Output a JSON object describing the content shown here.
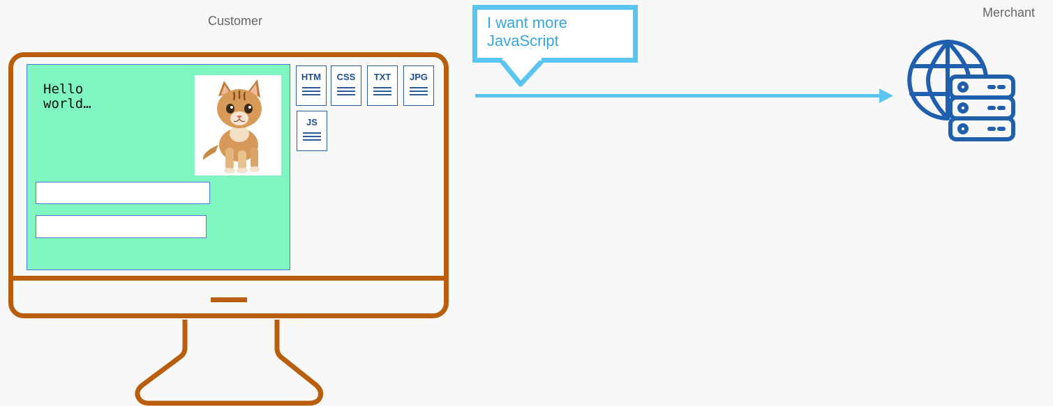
{
  "labels": {
    "customer": "Customer",
    "merchant": "Merchant"
  },
  "screen": {
    "hello_text": "Hello\nworld…"
  },
  "files": [
    {
      "type": "HTM"
    },
    {
      "type": "CSS"
    },
    {
      "type": "TXT"
    },
    {
      "type": "JPG"
    },
    {
      "type": "JS"
    }
  ],
  "bubble": {
    "text": "I want more JavaScript"
  },
  "colors": {
    "monitor": "#b95e0c",
    "screen": "#80f5c2",
    "screen_border": "#4a7bd8",
    "bubble_border": "#5bc5f2",
    "bubble_text": "#35a6e0",
    "arrow": "#5bc5f2",
    "server_icon": "#1f5fad",
    "file_icon": "#1f4f91"
  },
  "icons": {
    "kitten": "kitten-photo",
    "server": "globe-server-icon"
  }
}
